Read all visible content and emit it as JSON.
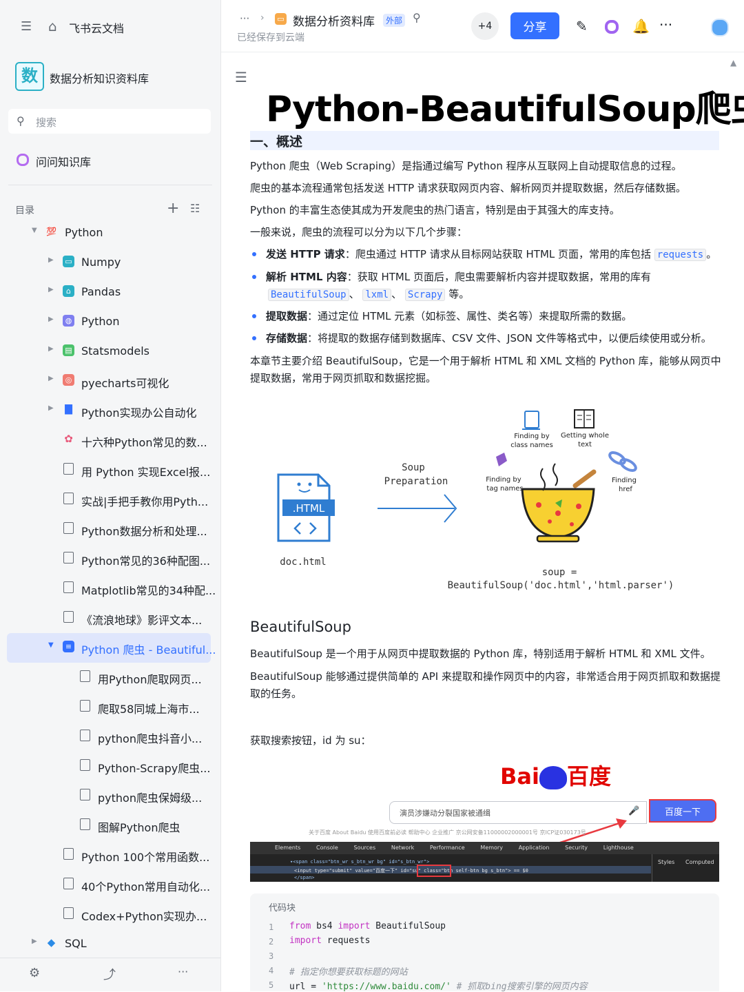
{
  "sidebar": {
    "brand": "飞书云文档",
    "kb_logo": "数",
    "kb_title": "数据分析知识资料库",
    "search_placeholder": "搜索",
    "ask_label": "问问知识库",
    "toc_label": "目录",
    "items": [
      {
        "label": "Python"
      },
      {
        "label": "Numpy"
      },
      {
        "label": "Pandas"
      },
      {
        "label": "Python"
      },
      {
        "label": "Statsmodels"
      },
      {
        "label": "pyecharts可视化"
      },
      {
        "label": "Python实现办公自动化"
      },
      {
        "label": "十六种Python常见的数..."
      },
      {
        "label": "用 Python 实现Excel报..."
      },
      {
        "label": "实战|手把手教你用Pyth..."
      },
      {
        "label": "Python数据分析和处理..."
      },
      {
        "label": "Python常见的36种配图..."
      },
      {
        "label": "Matplotlib常见的34种配..."
      },
      {
        "label": "《流浪地球》影评文本..."
      },
      {
        "label": "Python 爬虫 - Beautiful..."
      },
      {
        "label": "用Python爬取网页..."
      },
      {
        "label": "爬取58同城上海市..."
      },
      {
        "label": "python爬虫抖音小..."
      },
      {
        "label": "Python-Scrapy爬虫..."
      },
      {
        "label": "python爬虫保姆级..."
      },
      {
        "label": "图解Python爬虫"
      },
      {
        "label": "Python 100个常用函数..."
      },
      {
        "label": "40个Python常用自动化..."
      },
      {
        "label": "Codex+Python实现办..."
      },
      {
        "label": "SQL"
      }
    ]
  },
  "header": {
    "breadcrumb_more": "···",
    "doc_title": "数据分析资料库",
    "tag": "外部",
    "save_status": "已经保存到云端",
    "collaborators": "+4",
    "share_label": "分享",
    "more": "···"
  },
  "doc": {
    "title": "Python-BeautifulSoup爬虫",
    "section1": "一、概述",
    "p1": "Python 爬虫（Web Scraping）是指通过编写 Python 程序从互联网上自动提取信息的过程。",
    "p2": "爬虫的基本流程通常包括发送 HTTP 请求获取网页内容、解析网页并提取数据，然后存储数据。",
    "p3": "Python 的丰富生态使其成为开发爬虫的热门语言，特别是由于其强大的库支持。",
    "p4": "一般来说，爬虫的流程可以分为以下几个步骤：",
    "b1_bold": "发送 HTTP 请求",
    "b1_text": "：爬虫通过 HTTP 请求从目标网站获取 HTML 页面，常用的库包括",
    "b1_code": "requests",
    "b1_end": "。",
    "b2_bold": "解析 HTML 内容",
    "b2_text": "：获取 HTML 页面后，爬虫需要解析内容并提取数据，常用的库有",
    "b2_code1": "BeautifulSoup",
    "b2_sep1": "、",
    "b2_code2": "lxml",
    "b2_sep2": "、",
    "b2_code3": "Scrapy",
    "b2_end": "等。",
    "b3_bold": "提取数据",
    "b3_text": "：通过定位 HTML 元素（如标签、属性、类名等）来提取所需的数据。",
    "b4_bold": "存储数据",
    "b4_text": "：将提取的数据存储到数据库、CSV 文件、JSON 文件等格式中，以便后续使用或分析。",
    "p5a": "本章节主要介绍 BeautifulSoup，它是一个用于解析 HTML 和 XML 文档的 Python 库，能够从网页中",
    "p5b": "提取数据，常用于网页抓取和数据挖掘。",
    "diagram": {
      "file_badge": ".HTML",
      "file_name": "doc.html",
      "arrow_label1": "Soup",
      "arrow_label2": "Preparation",
      "l_class1": "Finding by",
      "l_class2": "class names",
      "l_whole1": "Getting whole",
      "l_whole2": "text",
      "l_tag1": "Finding by",
      "l_tag2": "tag names",
      "l_href1": "Finding",
      "l_href2": "href",
      "code1": "soup =",
      "code2": "BeautifulSoup('doc.html','html.parser')"
    },
    "section2": "BeautifulSoup",
    "p6": "BeautifulSoup 是一个用于从网页中提取数据的 Python 库，特别适用于解析 HTML 和 XML 文件。",
    "p7a": "BeautifulSoup 能够通过提供简单的 API 来提取和操作网页中的内容，非常适合用于网页抓取和数据提",
    "p7b": "取的任务。",
    "p8": "获取搜索按钮，id 为 su：",
    "baidu": {
      "logo_a": "Bai",
      "logo_b": "百度",
      "query": "演员涉嫌动分裂国家被通缉",
      "button": "百度一下",
      "links": "关于百度    About Baidu    使用百度前必读    帮助中心    企业推广    京公网安备11000002000001号    京ICP证030173号",
      "dev_tabs": [
        "Elements",
        "Console",
        "Sources",
        "Network",
        "Performance",
        "Memory",
        "Application",
        "Security",
        "Lighthouse"
      ],
      "dev_line1": "▾<span class=\"btn_wr s_btn_wr bg\" id=\"s_btn_wr\">",
      "dev_line2": "<input type=\"submit\" value=\"百度一下\" id=\"su\" class=\"btn self-btn bg s_btn\"> == $0",
      "dev_line3": "</span>",
      "dev_styles": "Styles",
      "dev_computed": "Computed"
    },
    "code_label": "代码块",
    "code": [
      {
        "n": "1",
        "kw": "from",
        "rest": " bs4 ",
        "kw2": "import",
        "rest2": " BeautifulSoup"
      },
      {
        "n": "2",
        "kw": "import",
        "rest": " requests",
        "kw2": "",
        "rest2": ""
      },
      {
        "n": "3",
        "kw": "",
        "rest": "",
        "kw2": "",
        "rest2": ""
      },
      {
        "n": "4",
        "comment": "# 指定你想要获取标题的网站"
      },
      {
        "n": "5",
        "rest": "url = ",
        "str": "'https://www.baidu.com/'",
        "comment": " # 抓取bing搜索引擎的网页内容"
      }
    ]
  },
  "colors": {
    "accent": "#3370ff",
    "baidu_red": "#e10601",
    "baidu_blue": "#2932e1"
  }
}
